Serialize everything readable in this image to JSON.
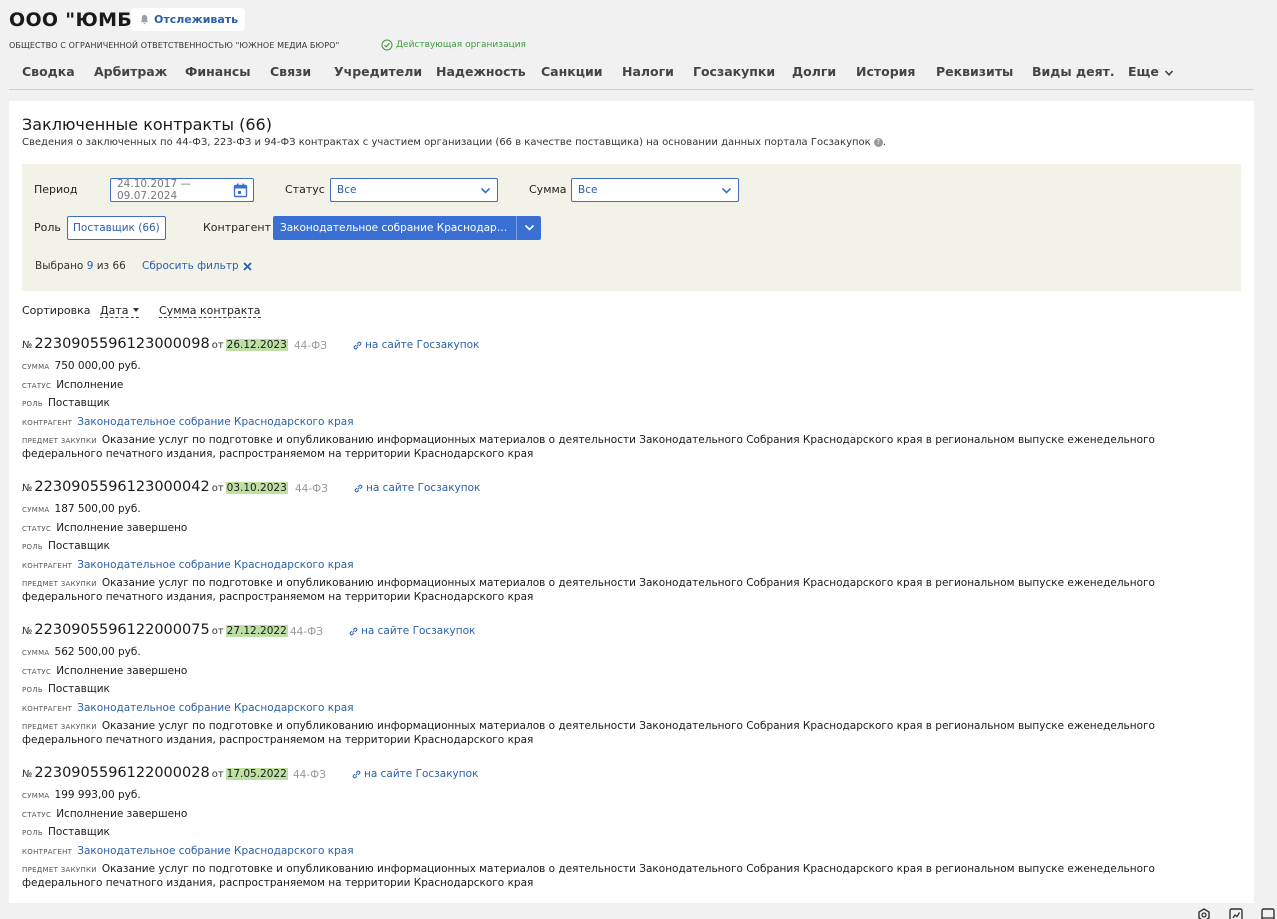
{
  "header": {
    "company_name": "ООО \"ЮМБ\"",
    "follow_label": "Отслеживать",
    "full_name": "ОБЩЕСТВО С ОГРАНИЧЕННОЙ ОТВЕТСТВЕННОСТЬЮ \"ЮЖНОЕ МЕДИА БЮРО\"",
    "status": "Действующая организация",
    "status_color": "#3f9a3f"
  },
  "nav": {
    "items": [
      "Сводка",
      "Арбитраж",
      "Финансы",
      "Связи",
      "Учредители",
      "Надежность",
      "Санкции",
      "Налоги",
      "Госзакупки",
      "Долги",
      "История",
      "Реквизиты",
      "Виды деят.",
      "Еще"
    ]
  },
  "section": {
    "title": "Заключенные контракты (66)",
    "description": "Сведения о заключенных по 44-ФЗ, 223-ФЗ и 94-ФЗ контрактах с участием организации (66 в качестве поставщика) на основании данных портала Госзакупок",
    "info_icon": "?"
  },
  "filters": {
    "period_label": "Период",
    "period_value": "24.10.2017 — 09.07.2024",
    "status_label": "Статус",
    "status_value": "Все",
    "sum_label": "Сумма",
    "sum_value": "Все",
    "role_label": "Роль",
    "role_value": "Поставщик (66)",
    "counterparty_label": "Контрагент",
    "counterparty_value": "Законодательное собрание Краснодарского края",
    "selected_prefix": "Выбрано",
    "selected_count": "9",
    "selected_of": "из 66",
    "reset_label": "Сбросить фильтр",
    "accent_color": "#3a70d4"
  },
  "sorting": {
    "label": "Сортировка",
    "by_date": "Дата",
    "by_sum": "Сумма контракта"
  },
  "labels": {
    "no": "№",
    "ot": "от",
    "sum": "сумма",
    "status": "статус",
    "role": "роль",
    "counterparty": "контрагент",
    "subject": "предмет закупки",
    "site_link": "на сайте Госзакупок"
  },
  "contracts": [
    {
      "number": "2230905596123000098",
      "date": "26.12.2023",
      "law": "44-ФЗ",
      "sum": "750 000,00 руб.",
      "status": "Исполнение",
      "role": "Поставщик",
      "counterparty": "Законодательное собрание Краснодарского края",
      "subject": "Оказание услуг по подготовке и опубликованию информационных материалов о деятельности Законодательного Собрания Краснодарского края в региональном выпуске еженедельного федерального печатного издания, распространяемом на территории Краснодарского края"
    },
    {
      "number": "2230905596123000042",
      "date": "03.10.2023",
      "law": "44-ФЗ",
      "sum": "187 500,00 руб.",
      "status": "Исполнение завершено",
      "role": "Поставщик",
      "counterparty": "Законодательное собрание Краснодарского края",
      "subject": "Оказание услуг по подготовке и опубликованию информационных материалов о деятельности Законодательного Собрания Краснодарского края в региональном выпуске еженедельного федерального печатного издания, распространяемом на территории Краснодарского края"
    },
    {
      "number": "2230905596122000075",
      "date": "27.12.2022",
      "law": "44-ФЗ",
      "sum": "562 500,00 руб.",
      "status": "Исполнение завершено",
      "role": "Поставщик",
      "counterparty": "Законодательное собрание Краснодарского края",
      "subject": "Оказание услуг по подготовке и опубликованию информационных материалов о деятельности Законодательного Собрания Краснодарского края в региональном выпуске еженедельного федерального печатного издания, распространяемом на территории Краснодарского края"
    },
    {
      "number": "2230905596122000028",
      "date": "17.05.2022",
      "law": "44-ФЗ",
      "sum": "199 993,00 руб.",
      "status": "Исполнение завершено",
      "role": "Поставщик",
      "counterparty": "Законодательное собрание Краснодарского края",
      "subject": "Оказание услуг по подготовке и опубликованию информационных материалов о деятельности Законодательного Собрания Краснодарского края в региональном выпуске еженедельного федерального печатного издания, распространяемом на территории Краснодарского края"
    }
  ],
  "icons": {
    "bell": "bell-icon",
    "check": "check-circle-icon",
    "calendar": "calendar-icon",
    "chevron": "chevron-down-icon",
    "close": "close-icon",
    "link": "link-icon"
  }
}
